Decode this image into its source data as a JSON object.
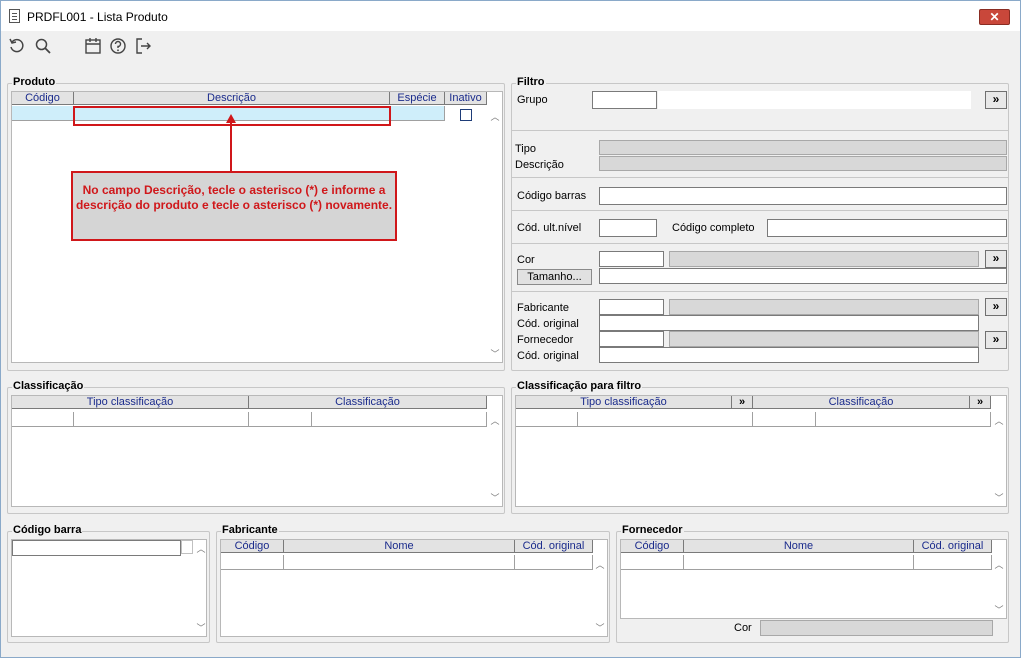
{
  "window": {
    "title": "PRDFL001 - Lista Produto",
    "close_label": "✕"
  },
  "toolbar": {
    "icons": [
      "refresh-icon",
      "search-icon",
      "calendar-icon",
      "help-icon",
      "exit-icon"
    ]
  },
  "produto": {
    "title": "Produto",
    "columns": [
      "Código",
      "Descrição",
      "Espécie",
      "Inativo"
    ]
  },
  "callout": {
    "text": "No campo Descrição, tecle o asterisco (*) e informe a descrição do produto e tecle o asterisco (*) novamente.",
    "color": "#d0171a"
  },
  "filtro": {
    "title": "Filtro",
    "grupo_label": "Grupo",
    "tipo_label": "Tipo",
    "descricao_label": "Descrição",
    "codigo_barras_label": "Código barras",
    "cod_ult_nivel_label": "Cód. ult.nível",
    "codigo_completo_label": "Código completo",
    "cor_label": "Cor",
    "tamanho_button": "Tamanho...",
    "fabricante_label": "Fabricante",
    "cod_original_label_1": "Cód. original",
    "fornecedor_label": "Fornecedor",
    "cod_original_label_2": "Cód. original",
    "lookup_button": "»"
  },
  "classificacao": {
    "title": "Classificação",
    "columns": [
      "Tipo classificação",
      "Classificação"
    ]
  },
  "classificacao_filtro": {
    "title": "Classificação para filtro",
    "columns": [
      "Tipo classificação",
      "Classificação"
    ],
    "lookup_button": "»"
  },
  "codigo_barra": {
    "title": "Código barra"
  },
  "fabricante": {
    "title": "Fabricante",
    "columns": [
      "Código",
      "Nome",
      "Cód. original"
    ]
  },
  "fornecedor": {
    "title": "Fornecedor",
    "columns": [
      "Código",
      "Nome",
      "Cód. original"
    ],
    "cor_label": "Cor"
  }
}
